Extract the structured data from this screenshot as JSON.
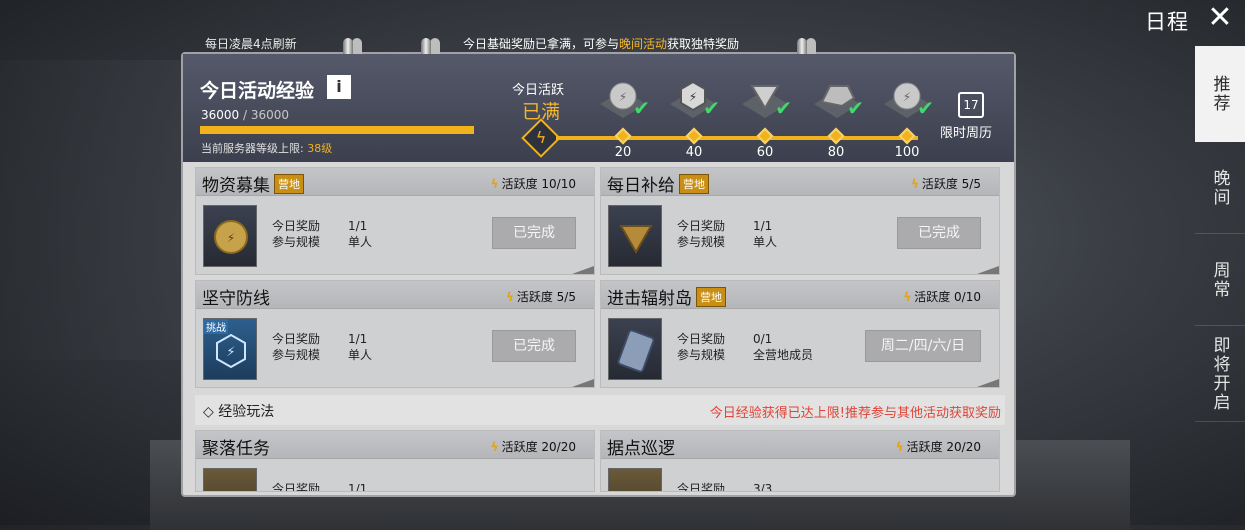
{
  "header": {
    "schedule_title": "日程",
    "refresh_note": "每日凌晨4点刷新",
    "notice_prefix": "今日基础奖励已拿满，可参与",
    "notice_link": "晚间活动",
    "notice_suffix": "获取独特奖励"
  },
  "right_tabs": [
    {
      "label": "推荐",
      "active": true
    },
    {
      "label": "晚间",
      "active": false
    },
    {
      "label": "周常",
      "active": false
    },
    {
      "label": "即将开启",
      "active": false
    }
  ],
  "exp": {
    "title": "今日活动经验",
    "info": "i",
    "current": "36000",
    "max": " / 36000",
    "progress": 1.0,
    "server_cap_label": "当前服务器等级上限: ",
    "server_cap_level": "38级"
  },
  "activity": {
    "label": "今日活跃",
    "status": "已满",
    "milestones": [
      "20",
      "40",
      "60",
      "80",
      "100"
    ],
    "calendar_day": "17",
    "calendar_label": "限时周历"
  },
  "cards": [
    {
      "title": "物资募集",
      "tag": "营地",
      "activity": "活跃度 10/10",
      "reward_label": "今日奖励",
      "reward": "1/1",
      "scale_label": "参与规模",
      "scale": "单人",
      "status": "已完成"
    },
    {
      "title": "每日补给",
      "tag": "营地",
      "activity": "活跃度   5/5",
      "reward_label": "今日奖励",
      "reward": "1/1",
      "scale_label": "参与规模",
      "scale": "单人",
      "status": "已完成"
    },
    {
      "title": "坚守防线",
      "tag": "",
      "badge": "挑战",
      "activity": "活跃度   5/5",
      "reward_label": "今日奖励",
      "reward": "1/1",
      "scale_label": "参与规模",
      "scale": "单人",
      "status": "已完成"
    },
    {
      "title": "进击辐射岛",
      "tag": "营地",
      "activity": "活跃度  0/10",
      "reward_label": "今日奖励",
      "reward": "0/1",
      "scale_label": "参与规模",
      "scale": "全营地成员",
      "status": "周二/四/六/日"
    },
    {
      "title": "聚落任务",
      "tag": "",
      "activity": "活跃度 20/20",
      "reward_label": "今日奖励",
      "reward": "1/1"
    },
    {
      "title": "据点巡逻",
      "tag": "",
      "activity": "活跃度 20/20",
      "reward_label": "今日奖励",
      "reward": "3/3"
    }
  ],
  "section": {
    "title": "◇ 经验玩法",
    "warning": "今日经验获得已达上限!推荐参与其他活动获取奖励"
  },
  "colors": {
    "accent": "#f2b21c",
    "warning": "#e04438",
    "check": "#3ddc6a"
  }
}
